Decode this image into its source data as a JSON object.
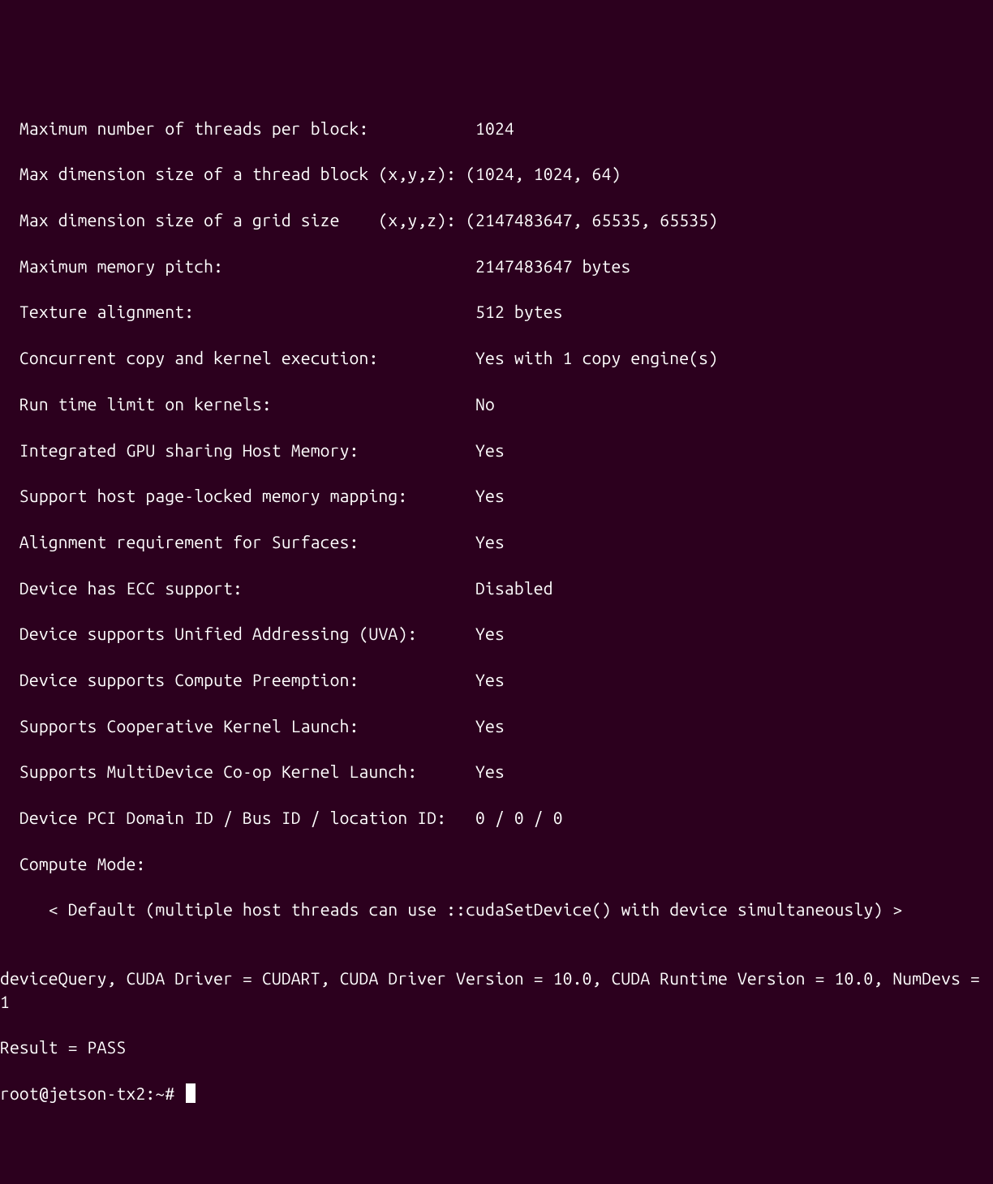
{
  "terminal": {
    "lines": [
      "  Maximum number of threads per block:           1024",
      "  Max dimension size of a thread block (x,y,z): (1024, 1024, 64)",
      "  Max dimension size of a grid size    (x,y,z): (2147483647, 65535, 65535)",
      "  Maximum memory pitch:                          2147483647 bytes",
      "  Texture alignment:                             512 bytes",
      "  Concurrent copy and kernel execution:          Yes with 1 copy engine(s)",
      "  Run time limit on kernels:                     No",
      "  Integrated GPU sharing Host Memory:            Yes",
      "  Support host page-locked memory mapping:       Yes",
      "  Alignment requirement for Surfaces:            Yes",
      "  Device has ECC support:                        Disabled",
      "  Device supports Unified Addressing (UVA):      Yes",
      "  Device supports Compute Preemption:            Yes",
      "  Supports Cooperative Kernel Launch:            Yes",
      "  Supports MultiDevice Co-op Kernel Launch:      Yes",
      "  Device PCI Domain ID / Bus ID / location ID:   0 / 0 / 0",
      "  Compute Mode:",
      "     < Default (multiple host threads can use ::cudaSetDevice() with device simultaneously) >",
      "",
      "deviceQuery, CUDA Driver = CUDART, CUDA Driver Version = 10.0, CUDA Runtime Version = 10.0, NumDevs = 1",
      "Result = PASS"
    ],
    "prompt": "root@jetson-tx2:~# "
  },
  "device_properties": {
    "max_threads_per_block": 1024,
    "max_thread_block_dim": [
      1024,
      1024,
      64
    ],
    "max_grid_dim": [
      2147483647,
      65535,
      65535
    ],
    "max_memory_pitch": "2147483647 bytes",
    "texture_alignment": "512 bytes",
    "concurrent_copy_kernel": "Yes with 1 copy engine(s)",
    "runtime_limit_kernels": "No",
    "integrated_gpu_host_memory": "Yes",
    "page_locked_memory_mapping": "Yes",
    "surface_alignment_requirement": "Yes",
    "ecc_support": "Disabled",
    "unified_addressing": "Yes",
    "compute_preemption": "Yes",
    "cooperative_kernel_launch": "Yes",
    "multidevice_coop_kernel_launch": "Yes",
    "pci_domain_bus_location": "0 / 0 / 0",
    "compute_mode": "Default (multiple host threads can use ::cudaSetDevice() with device simultaneously)"
  },
  "summary": {
    "cuda_driver": "CUDART",
    "cuda_driver_version": "10.0",
    "cuda_runtime_version": "10.0",
    "num_devs": 1,
    "result": "PASS"
  }
}
